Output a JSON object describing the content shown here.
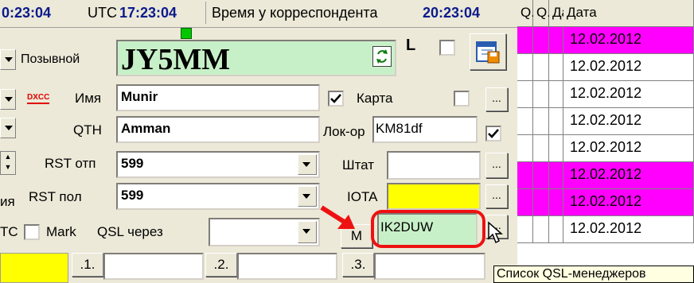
{
  "time_bar": {
    "local_time": "0:23:04",
    "utc_label": "UTC",
    "utc_time": "17:23:04",
    "corr_label": "Время у корреспондента",
    "corr_time": "20:23:04"
  },
  "form": {
    "callsign_label": "Позывной",
    "callsign_value": "JY5MM",
    "l_label": "L",
    "dxcc_label": "DXCC",
    "name_label": "Имя",
    "name_value": "Munir",
    "card_label": "Карта",
    "qth_label": "QTH",
    "qth_value": "Amman",
    "locator_label": "Лок-ор",
    "locator_value": "KM81df",
    "rst_sent_label": "RST отп",
    "rst_sent_value": "599",
    "state_label": "Штат",
    "rst_rcvd_prefix": "ия",
    "rst_rcvd_label": "RST пол",
    "rst_rcvd_value": "599",
    "iota_label": "IOTA",
    "utc_prefix": "TC",
    "mark_label": "Mark",
    "qsl_via_label": "QSL через",
    "m_button": "M",
    "qsl_manager_value": "IK2DUW",
    "ellipsis": "...",
    "btn1": ".1.",
    "btn2": ".2.",
    "btn3": ".3.",
    "tooltip": "Список QSL-менеджеров"
  },
  "log_grid": {
    "headers": [
      "Q.",
      "Q.",
      "Дата"
    ],
    "rows": [
      {
        "date": "12.02.2012",
        "highlight": true
      },
      {
        "date": "12.02.2012",
        "highlight": false
      },
      {
        "date": "12.02.2012",
        "highlight": false
      },
      {
        "date": "12.02.2012",
        "highlight": false
      },
      {
        "date": "12.02.2012",
        "highlight": false
      },
      {
        "date": "12.02.2012",
        "highlight": true
      },
      {
        "date": "12.02.2012",
        "highlight": true
      },
      {
        "date": "12.02.2012",
        "highlight": false
      }
    ],
    "highlight_color": "#ff00ff"
  },
  "colors": {
    "callsign_bg": "#c8f0c8",
    "qsl_manager_bg": "#c8f0c8",
    "iota_bg": "#ffff00",
    "annotation_red": "#ee1111"
  }
}
